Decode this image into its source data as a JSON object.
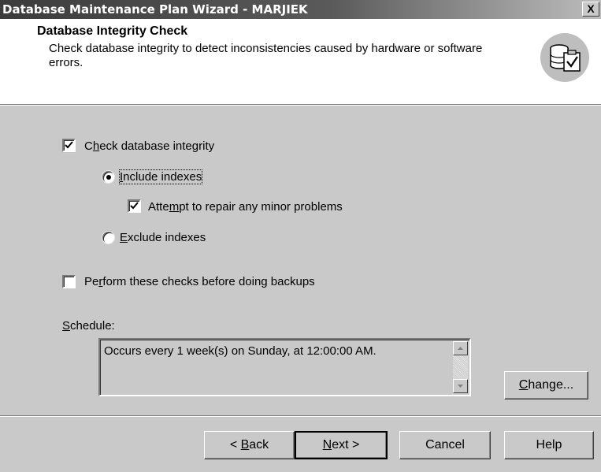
{
  "window": {
    "title": "Database Maintenance Plan Wizard - MARJIEK",
    "close_glyph": "X"
  },
  "header": {
    "title": "Database Integrity Check",
    "description": "Check database integrity to detect inconsistencies caused by hardware or software errors.",
    "icon": "database-check-icon"
  },
  "options": {
    "check_integrity": {
      "pre": "",
      "key": "h",
      "prefix": "C",
      "rest": "eck database integrity",
      "checked": true
    },
    "include_indexes": {
      "prefix": "",
      "key": "I",
      "rest": "nclude indexes",
      "selected": true
    },
    "attempt_repair": {
      "prefix": "Atte",
      "key": "m",
      "rest": "pt to repair any minor problems",
      "checked": true
    },
    "exclude_indexes": {
      "prefix": "",
      "key": "E",
      "rest": "xclude indexes",
      "selected": false
    },
    "before_backups": {
      "prefix": "Pe",
      "key": "r",
      "rest": "form these checks before doing backups",
      "checked": false
    }
  },
  "schedule": {
    "label_key": "S",
    "label_rest": "chedule:",
    "text": "Occurs every 1 week(s) on Sunday, at 12:00:00 AM."
  },
  "buttons": {
    "change": {
      "key": "C",
      "rest": "hange..."
    },
    "back": {
      "pre": "< ",
      "key": "B",
      "rest": "ack"
    },
    "next": {
      "key": "N",
      "rest": "ext >"
    },
    "cancel": "Cancel",
    "help": "Help"
  }
}
